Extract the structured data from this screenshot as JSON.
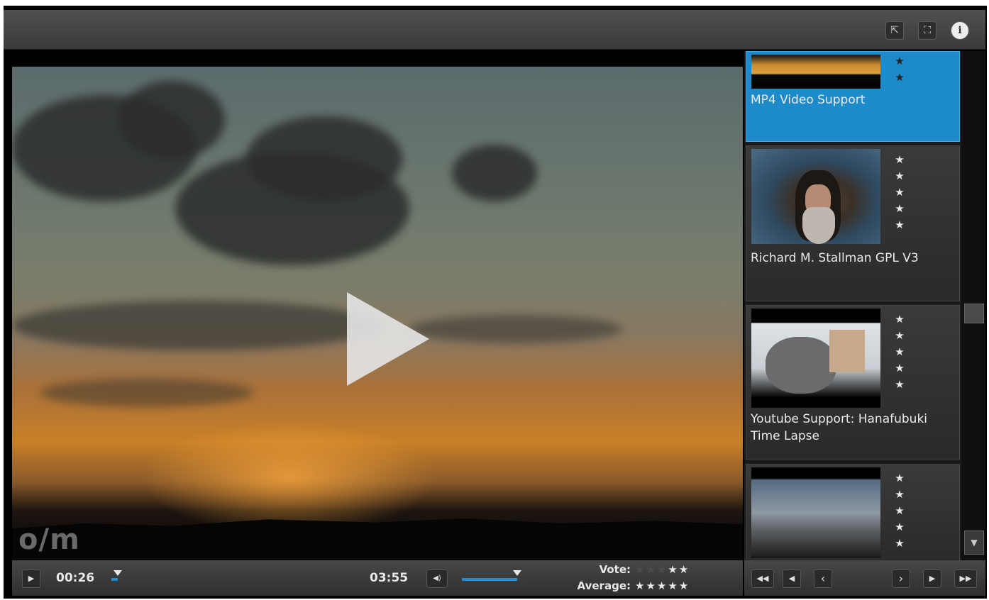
{
  "topbar": {
    "buttons": [
      {
        "icon": "share-icon",
        "glyph": "⇱"
      },
      {
        "icon": "fullscreen-icon",
        "glyph": "⛶"
      },
      {
        "icon": "info-icon",
        "glyph": "i"
      }
    ]
  },
  "video": {
    "logo_text": "o/m",
    "play_icon": "play-icon"
  },
  "playlist": {
    "items": [
      {
        "title": "MP4 Video Support",
        "active": true,
        "stars": [
          "★",
          "★"
        ]
      },
      {
        "title": "Richard M. Stallman GPL V3",
        "active": false,
        "stars": [
          "★",
          "★",
          "★",
          "★",
          "★"
        ]
      },
      {
        "title": "Youtube Support: Hanafubuki Time Lapse",
        "active": false,
        "stars": [
          "★",
          "★",
          "★",
          "★",
          "★"
        ]
      },
      {
        "title": "",
        "active": false,
        "stars": [
          "★",
          "★",
          "★",
          "★",
          "★"
        ]
      }
    ]
  },
  "controls": {
    "play_glyph": "▶",
    "current_time": "00:26",
    "duration": "03:55",
    "volume_glyph": "◀)",
    "seek_fraction": 0.11,
    "volume_fraction": 0.85,
    "vote_label": "Vote:",
    "average_label": "Average:",
    "vote_stars": 2,
    "average_stars": 5,
    "star_glyph": "★"
  },
  "navigation": {
    "buttons": [
      {
        "name": "first-page-icon",
        "glyph": "◀◀"
      },
      {
        "name": "previous-page-icon",
        "glyph": "◀"
      },
      {
        "name": "previous-item-icon",
        "glyph": "‹"
      },
      {
        "name": "next-item-icon",
        "glyph": "›"
      },
      {
        "name": "next-page-icon",
        "glyph": "▶"
      },
      {
        "name": "last-page-icon",
        "glyph": "▶▶"
      }
    ]
  },
  "colors": {
    "accent": "#1d8ac9",
    "bar": "#3a3a3a"
  }
}
